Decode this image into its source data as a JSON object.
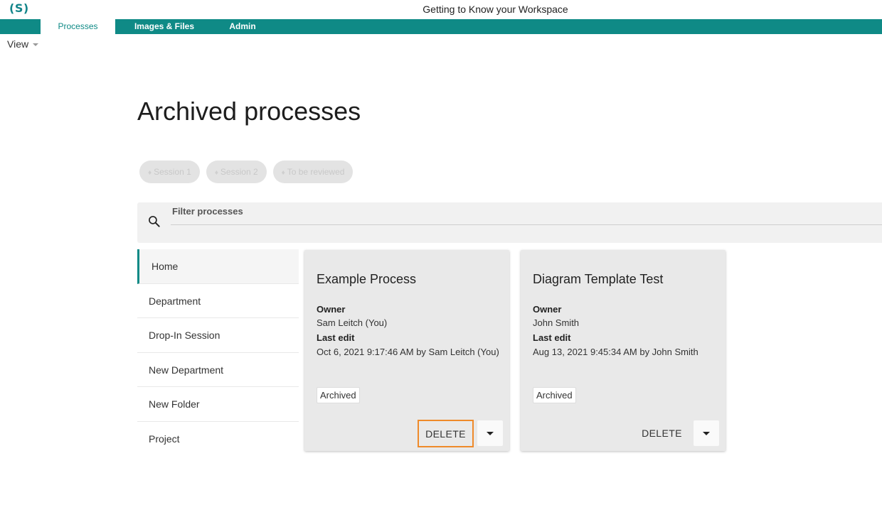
{
  "app": {
    "logo": "(S)",
    "window_title": "Getting to Know your Workspace"
  },
  "nav": {
    "tabs": [
      {
        "label": "Processes"
      },
      {
        "label": "Images & Files"
      },
      {
        "label": "Admin"
      }
    ]
  },
  "view_menu": {
    "label": "View"
  },
  "page": {
    "title": "Archived processes"
  },
  "tag_chips": [
    {
      "label": "Session 1"
    },
    {
      "label": "Session 2"
    },
    {
      "label": "To be reviewed"
    }
  ],
  "filter": {
    "placeholder": "Filter processes",
    "value": ""
  },
  "sidebar": {
    "items": [
      {
        "label": "Home"
      },
      {
        "label": "Department"
      },
      {
        "label": "Drop-In Session"
      },
      {
        "label": "New Department"
      },
      {
        "label": "New Folder"
      },
      {
        "label": "Project"
      }
    ]
  },
  "cards": [
    {
      "title": "Example Process",
      "owner_label": "Owner",
      "owner": "Sam Leitch (You)",
      "last_edit_label": "Last edit",
      "last_edit": "Oct 6, 2021 9:17:46 AM by Sam Leitch (You)",
      "status": "Archived",
      "delete_label": "DELETE"
    },
    {
      "title": "Diagram Template Test",
      "owner_label": "Owner",
      "owner": "John Smith",
      "last_edit_label": "Last edit",
      "last_edit": "Aug 13, 2021 9:45:34 AM by John Smith",
      "status": "Archived",
      "delete_label": "DELETE"
    }
  ],
  "colors": {
    "brand_teal": "#0f8a86",
    "highlight_orange": "#ef8a2a"
  }
}
